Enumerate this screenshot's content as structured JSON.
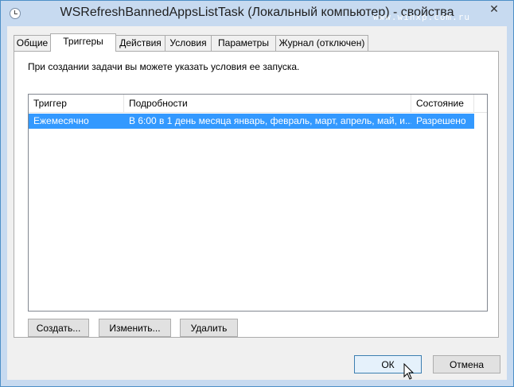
{
  "window": {
    "title": "WSRefreshBannedAppsListTask (Локальный компьютер) - свойства",
    "watermark": "www.winxp.com.ru",
    "close_glyph": "✕"
  },
  "tabs": [
    {
      "label": "Общие",
      "active": false
    },
    {
      "label": "Триггеры",
      "active": true
    },
    {
      "label": "Действия",
      "active": false
    },
    {
      "label": "Условия",
      "active": false
    },
    {
      "label": "Параметры",
      "active": false
    },
    {
      "label": "Журнал (отключен)",
      "active": false
    }
  ],
  "triggers_tab": {
    "description": "При создании задачи вы можете указать условия ее запуска.",
    "columns": [
      "Триггер",
      "Подробности",
      "Состояние"
    ],
    "rows": [
      {
        "trigger": "Ежемесячно",
        "details": "В 6:00 в 1 день месяца январь, февраль, март, апрель, май, и...",
        "status": "Разрешено",
        "selected": true
      }
    ],
    "buttons": {
      "create": "Создать...",
      "edit": "Изменить...",
      "delete": "Удалить"
    }
  },
  "dialog_buttons": {
    "ok": "ОК",
    "cancel": "Отмена"
  },
  "colors": {
    "titlebar": "#c7daf0",
    "selection": "#3399ff",
    "border": "#4d8fc7"
  },
  "icons": [
    "clock-icon",
    "close-icon",
    "mouse-cursor-icon"
  ]
}
